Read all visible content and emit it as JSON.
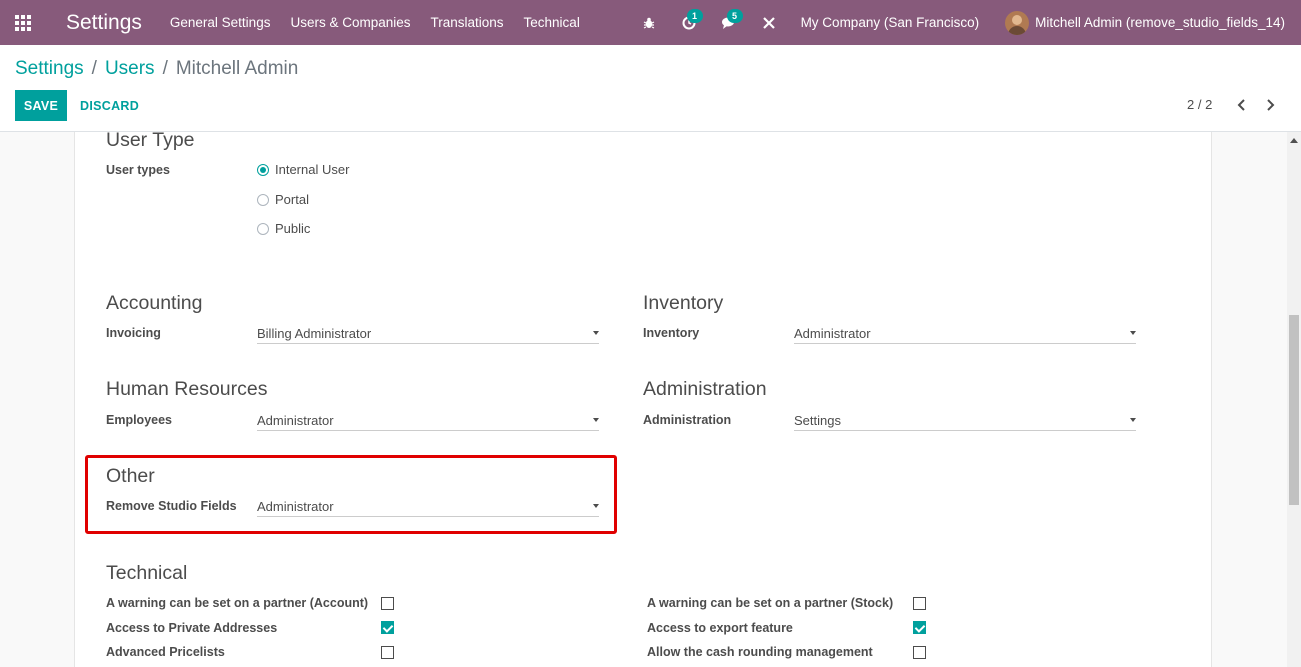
{
  "navbar": {
    "brand": "Settings",
    "menu": [
      "General Settings",
      "Users & Companies",
      "Translations",
      "Technical"
    ],
    "activity_count": "1",
    "messages_count": "5",
    "company": "My Company (San Francisco)",
    "user": "Mitchell Admin (remove_studio_fields_14)"
  },
  "breadcrumb": {
    "root": "Settings",
    "sep": "/",
    "parent": "Users",
    "current": "Mitchell Admin"
  },
  "actions": {
    "save": "SAVE",
    "discard": "DISCARD"
  },
  "pager": {
    "value": "2 / 2"
  },
  "user_type": {
    "title": "User Type",
    "label": "User types",
    "options": [
      "Internal User",
      "Portal",
      "Public"
    ],
    "selected": "Internal User"
  },
  "accounting": {
    "title": "Accounting",
    "label": "Invoicing",
    "value": "Billing Administrator"
  },
  "inventory": {
    "title": "Inventory",
    "label": "Inventory",
    "value": "Administrator"
  },
  "hr": {
    "title": "Human Resources",
    "label": "Employees",
    "value": "Administrator"
  },
  "administration": {
    "title": "Administration",
    "label": "Administration",
    "value": "Settings"
  },
  "other": {
    "title": "Other",
    "label": "Remove Studio Fields",
    "value": "Administrator"
  },
  "technical": {
    "title": "Technical",
    "left": [
      {
        "label": "A warning can be set on a partner (Account)",
        "checked": false
      },
      {
        "label": "Access to Private Addresses",
        "checked": true
      },
      {
        "label": "Advanced Pricelists",
        "checked": false
      }
    ],
    "right": [
      {
        "label": "A warning can be set on a partner (Stock)",
        "checked": false
      },
      {
        "label": "Access to export feature",
        "checked": true
      },
      {
        "label": "Allow the cash rounding management",
        "checked": false
      }
    ]
  },
  "colors": {
    "navbar": "#875a7b",
    "accent": "#00a09d",
    "highlight": "#e00000"
  }
}
